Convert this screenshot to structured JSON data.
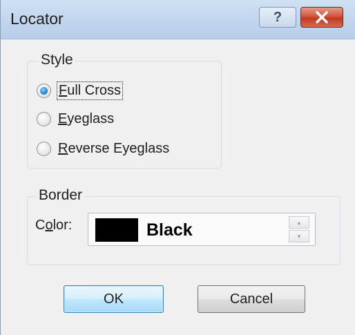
{
  "window": {
    "title": "Locator"
  },
  "titlebar": {
    "help_symbol": "?",
    "close_symbol": "✕"
  },
  "style_group": {
    "label": "Style",
    "options": [
      {
        "mnemonic": "F",
        "rest": "ull Cross",
        "checked": true
      },
      {
        "mnemonic": "E",
        "rest": "yeglass",
        "checked": false
      },
      {
        "mnemonic": "R",
        "rest": "everse Eyeglass",
        "checked": false
      }
    ]
  },
  "border_group": {
    "label": "Border",
    "color_label_pre": "C",
    "color_label_mnemonic": "o",
    "color_label_post": "lor:",
    "color_value": "Black",
    "color_swatch": "#000000",
    "spin_up_symbol": "▲",
    "spin_down_symbol": "▼"
  },
  "buttons": {
    "ok": "OK",
    "cancel": "Cancel"
  },
  "icons": {
    "help": "help-icon",
    "close": "close-icon"
  }
}
